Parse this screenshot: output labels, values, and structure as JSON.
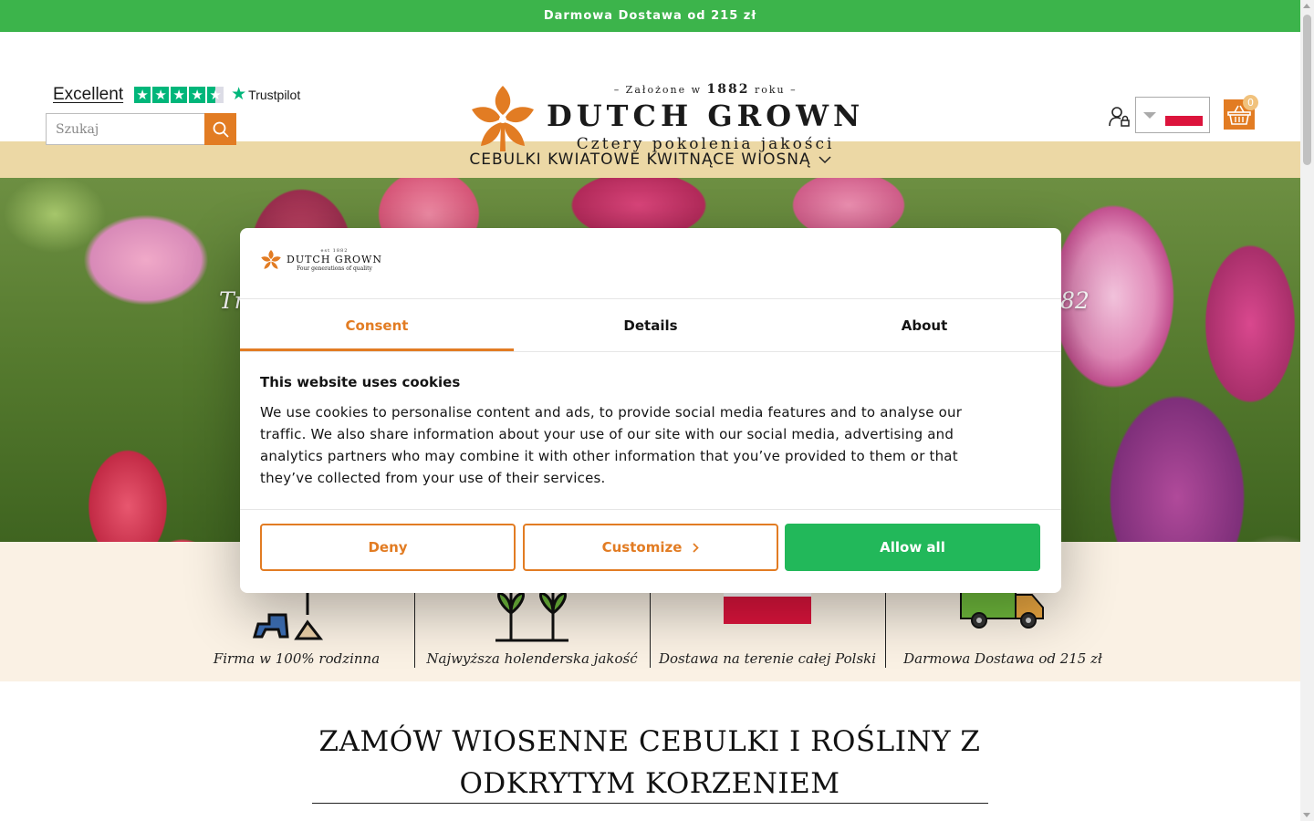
{
  "topbar": {
    "text": "Darmowa Dostawa od 215 zł"
  },
  "trustpilot": {
    "rating_word": "Excellent",
    "brand": "Trustpilot",
    "stars": 4.5
  },
  "search": {
    "placeholder": "Szukaj"
  },
  "logo": {
    "since": "– Założone w",
    "year": "1882",
    "since_suffix": "roku –",
    "name": "DUTCH GROWN",
    "tagline": "Cztery pokolenia jakości"
  },
  "header": {
    "cart_count": "0",
    "country_flag": "PL"
  },
  "nav": {
    "item": "CEBULKI KWIATOWE KWITNĄCE WIOSNĄ"
  },
  "hero": {
    "text_left": "Tr",
    "text_right": "82"
  },
  "features": [
    {
      "label": "Firma w 100% rodzinna",
      "icon": "family-gardener-icon"
    },
    {
      "label": "Najwyższa holenderska jakość",
      "icon": "seedlings-icon"
    },
    {
      "label": "Dostawa na terenie całej Polski",
      "icon": "poland-flag-icon"
    },
    {
      "label": "Darmowa Dostawa od 215 zł",
      "icon": "delivery-truck-icon"
    }
  ],
  "section": {
    "heading": "ZAMÓW WIOSENNE CEBULKI I ROŚLINY Z ODKRYTYM KORZENIEM"
  },
  "cookie": {
    "logo": {
      "since": "est 1882",
      "name": "DUTCH GROWN",
      "tagline": "Four generations of quality"
    },
    "tabs": [
      "Consent",
      "Details",
      "About"
    ],
    "active_tab": "Consent",
    "title": "This website uses cookies",
    "body": "We use cookies to personalise content and ads, to provide social media features and to analyse our traffic. We also share information about your use of our site with our social media, advertising and analytics partners who may combine it with other information that you’ve provided to them or that they’ve collected from your use of their services.",
    "deny": "Deny",
    "customize": "Customize",
    "allow": "Allow all"
  },
  "colors": {
    "green": "#3cb44b",
    "orange": "#e27c23",
    "nav_bg": "#ecd8a5",
    "allow_green": "#22b85a"
  }
}
